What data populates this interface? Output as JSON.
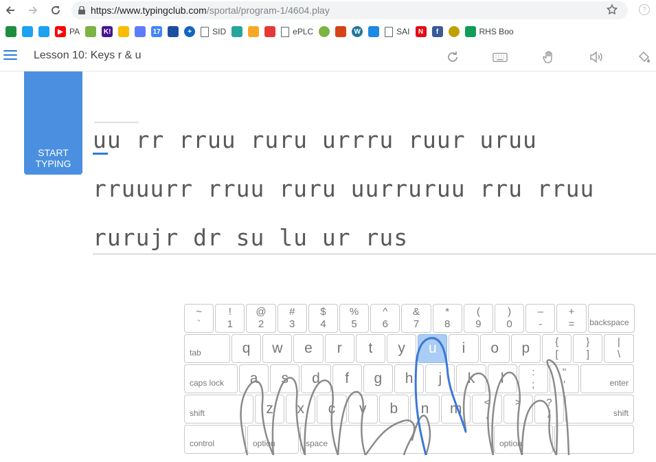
{
  "browser": {
    "url_host": "https://www.typingclub.com",
    "url_path": "/sportal/program-1/4604.play",
    "help_glyph": "?"
  },
  "bookmarks": [
    {
      "icon": "classroom-icon",
      "label": "",
      "color": "#1e8e3e",
      "glyph": ""
    },
    {
      "icon": "twitter-icon",
      "label": "",
      "color": "#1da1f2",
      "glyph": ""
    },
    {
      "icon": "twitter-square-icon",
      "label": "",
      "color": "#1da1f2",
      "glyph": ""
    },
    {
      "icon": "youtube-icon",
      "label": "PA",
      "color": "#ff0000",
      "glyph": "▶"
    },
    {
      "icon": "pear-icon",
      "label": "",
      "color": "#7cb342",
      "glyph": ""
    },
    {
      "icon": "kahoot-icon",
      "label": "",
      "color": "#46178f",
      "glyph": "K!"
    },
    {
      "icon": "drive-icon",
      "label": "",
      "color": "#fbbc04",
      "glyph": ""
    },
    {
      "icon": "robot-icon",
      "label": "",
      "color": "#5c7cfa",
      "glyph": ""
    },
    {
      "icon": "calendar-icon",
      "label": "",
      "color": "#4285f4",
      "glyph": "17"
    },
    {
      "icon": "layout-icon",
      "label": "",
      "color": "#1a4fa0",
      "glyph": ""
    },
    {
      "icon": "plus-circle-icon",
      "label": "",
      "color": "#1565c0",
      "glyph": "+"
    },
    {
      "icon": "page-icon",
      "label": "SID",
      "color": "#ffffff",
      "glyph": ""
    },
    {
      "icon": "hex-icon",
      "label": "",
      "color": "#26a69a",
      "glyph": ""
    },
    {
      "icon": "contact-card-icon",
      "label": "",
      "color": "#f9a825",
      "glyph": ""
    },
    {
      "icon": "bulb-icon",
      "label": "",
      "color": "#e53935",
      "glyph": ""
    },
    {
      "icon": "page-icon",
      "label": "ePLC",
      "color": "#ffffff",
      "glyph": ""
    },
    {
      "icon": "green-dot-icon",
      "label": "",
      "color": "#7cb342",
      "glyph": ""
    },
    {
      "icon": "office-icon",
      "label": "",
      "color": "#d84315",
      "glyph": ""
    },
    {
      "icon": "wordpress-icon",
      "label": "",
      "color": "#21759b",
      "glyph": "W"
    },
    {
      "icon": "feed-icon",
      "label": "",
      "color": "#1e88e5",
      "glyph": ""
    },
    {
      "icon": "page-icon",
      "label": "SAI",
      "color": "#ffffff",
      "glyph": ""
    },
    {
      "icon": "netflix-icon",
      "label": "",
      "color": "#e50914",
      "glyph": "N"
    },
    {
      "icon": "facebook-icon",
      "label": "",
      "color": "#3b5998",
      "glyph": "f"
    },
    {
      "icon": "ball-icon",
      "label": "",
      "color": "#c0a000",
      "glyph": ""
    },
    {
      "icon": "sheets-icon",
      "label": "RHS Boo",
      "color": "#0f9d58",
      "glyph": ""
    }
  ],
  "header": {
    "title": "Lesson 10: Keys r & u"
  },
  "start_button": {
    "label": "START\nTYPING"
  },
  "typing": {
    "line1": "uu rr rruu ruru urrru ruur uruu",
    "line2": "rruuurr rruu ruru uurruruu rru rruu",
    "line3": "rurujr dr su lu ur rus"
  },
  "keyboard": {
    "row1": [
      {
        "top": "~",
        "bottom": "`"
      },
      {
        "top": "!",
        "bottom": "1"
      },
      {
        "top": "@",
        "bottom": "2"
      },
      {
        "top": "#",
        "bottom": "3"
      },
      {
        "top": "$",
        "bottom": "4"
      },
      {
        "top": "%",
        "bottom": "5"
      },
      {
        "top": "^",
        "bottom": "6"
      },
      {
        "top": "&",
        "bottom": "7"
      },
      {
        "top": "*",
        "bottom": "8"
      },
      {
        "top": "(",
        "bottom": "9"
      },
      {
        "top": ")",
        "bottom": "0"
      },
      {
        "top": "–",
        "bottom": "-"
      },
      {
        "top": "+",
        "bottom": "="
      }
    ],
    "backspace": "backspace",
    "tab": "tab",
    "row2": [
      "q",
      "w",
      "e",
      "r",
      "t",
      "y",
      "u",
      "i",
      "o",
      "p"
    ],
    "row2_sym": [
      {
        "top": "{",
        "bottom": "["
      },
      {
        "top": "}",
        "bottom": "]"
      },
      {
        "top": "|",
        "bottom": "\\"
      }
    ],
    "caps": "caps lock",
    "row3": [
      "a",
      "s",
      "d",
      "f",
      "g",
      "h",
      "j",
      "k",
      "l"
    ],
    "row3_sym": [
      {
        "top": ":",
        "bottom": ";"
      },
      {
        "top": "\"",
        "bottom": "'"
      }
    ],
    "enter": "enter",
    "shift_left": "shift",
    "row4": [
      "z",
      "x",
      "c",
      "v",
      "b",
      "n",
      "m"
    ],
    "row4_sym": [
      {
        "top": "<",
        "bottom": ","
      },
      {
        "top": ">",
        "bottom": "."
      },
      {
        "top": "?",
        "bottom": "/"
      }
    ],
    "shift_right": "shift",
    "control": "control",
    "option_left": "option",
    "space": "space",
    "option_right": "option",
    "highlight_key": "u",
    "highlight_color": "#a9cdf4"
  }
}
